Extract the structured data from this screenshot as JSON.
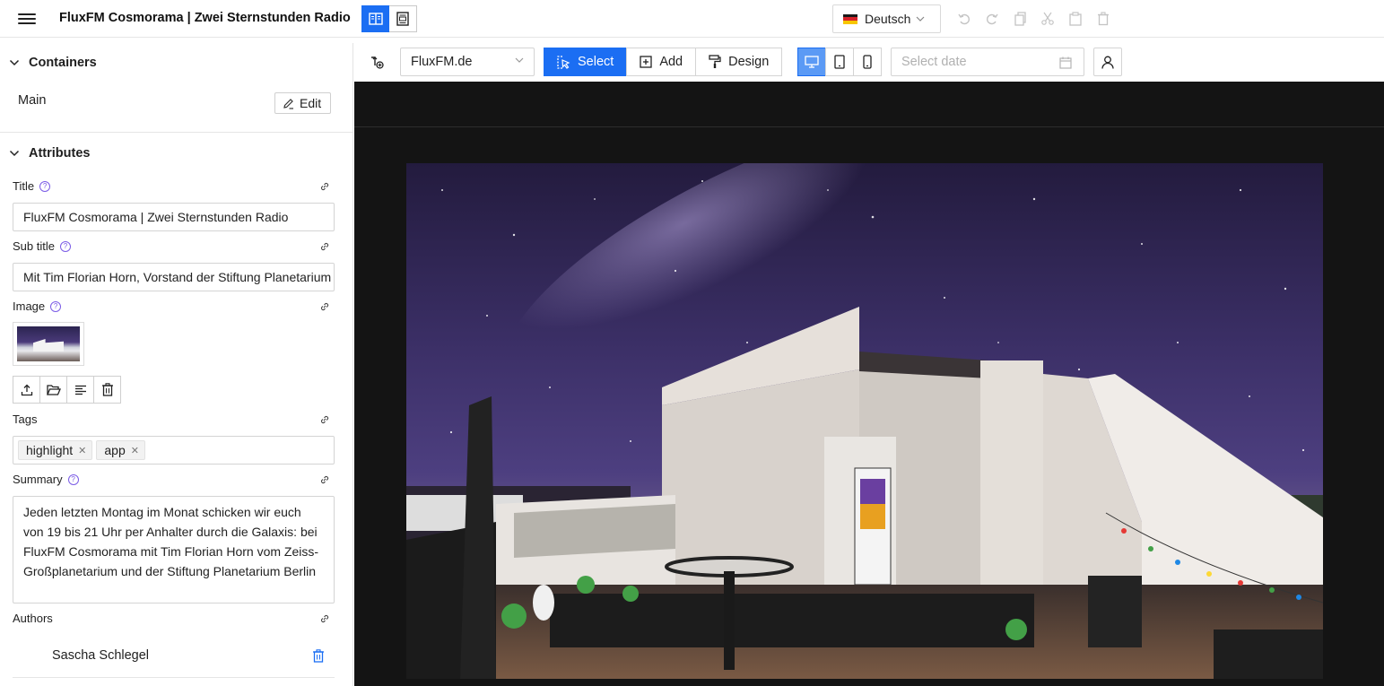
{
  "header": {
    "title": "FluxFM Cosmorama | Zwei Sternstunden Radio",
    "language": "Deutsch",
    "icons": [
      "menu-icon",
      "split-view-icon",
      "page-view-icon",
      "undo-icon",
      "redo-icon",
      "copy-icon",
      "cut-icon",
      "paste-icon",
      "delete-icon"
    ]
  },
  "containers": {
    "heading": "Containers",
    "items": [
      {
        "name": "Main",
        "action": "Edit"
      }
    ]
  },
  "attributes": {
    "heading": "Attributes",
    "title_label": "Title",
    "title_value": "FluxFM Cosmorama | Zwei Sternstunden Radio",
    "subtitle_label": "Sub title",
    "subtitle_value": "Mit Tim Florian Horn, Vorstand der Stiftung Planetarium Berlin",
    "image_label": "Image",
    "tags_label": "Tags",
    "tags": [
      "highlight",
      "app"
    ],
    "summary_label": "Summary",
    "summary_value": "Jeden letzten Montag im Monat schicken wir euch von 19 bis 21 Uhr per Anhalter durch die Galaxis: bei FluxFM Cosmorama mit Tim Florian Horn vom Zeiss-Großplanetarium und der Stiftung Planetarium Berlin",
    "authors_label": "Authors",
    "authors": [
      "Sascha Schlegel"
    ]
  },
  "toolbar": {
    "site": "FluxFM.de",
    "modes": [
      "Select",
      "Add",
      "Design"
    ],
    "active_mode": "Select",
    "devices": [
      "desktop",
      "tablet",
      "mobile"
    ],
    "active_device": "desktop",
    "date_placeholder": "Select date"
  },
  "colors": {
    "accent": "#1b6ef3",
    "help": "#7b5ce6",
    "preview_bg": "#141414"
  }
}
